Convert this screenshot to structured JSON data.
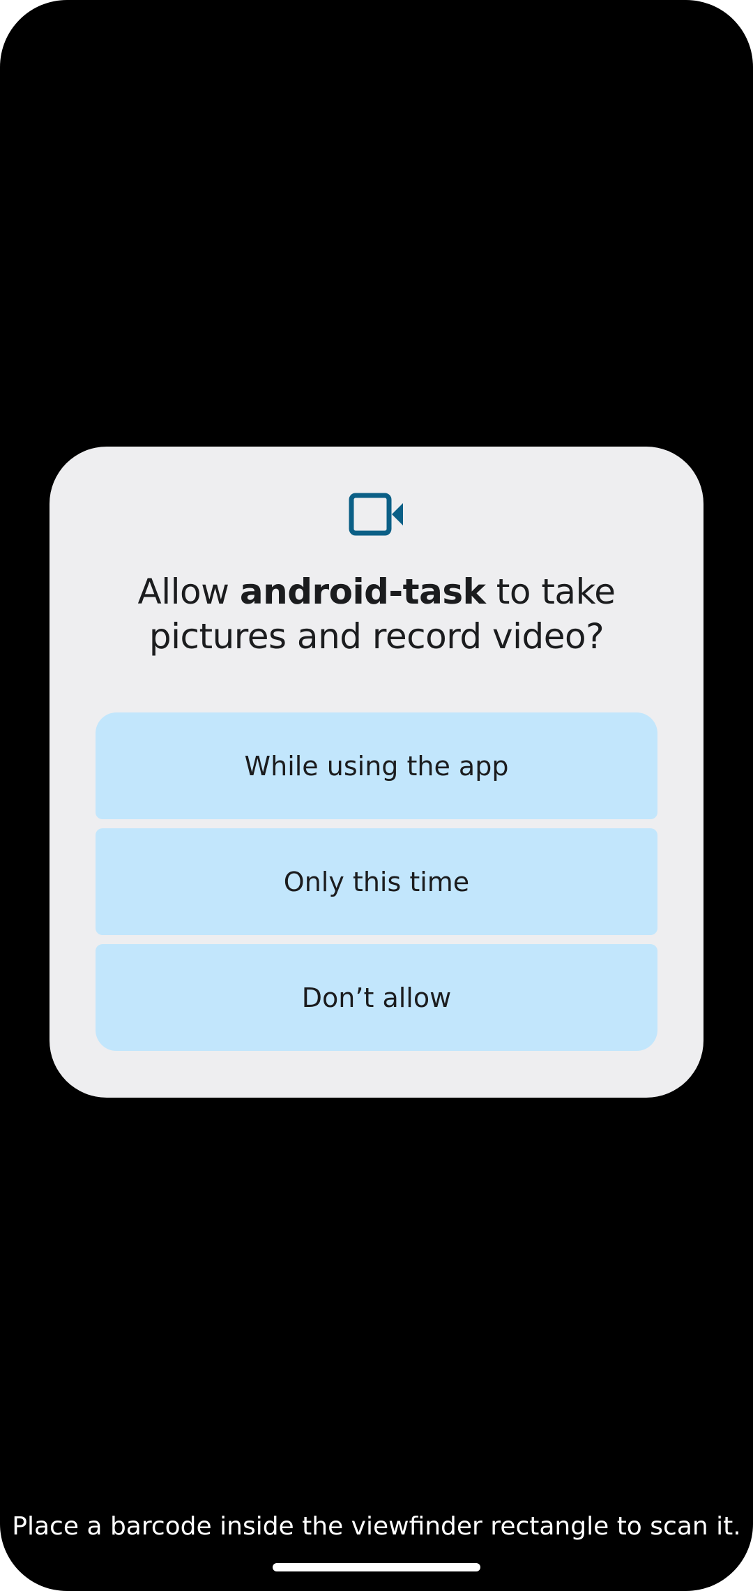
{
  "dialog": {
    "icon": "video-camera-icon",
    "title_prefix": "Allow ",
    "title_app": "android-task",
    "title_suffix": " to take pictures and record video?",
    "buttons": {
      "while_using": "While using the app",
      "only_this_time": "Only this time",
      "dont_allow": "Don’t allow"
    }
  },
  "scanner": {
    "hint": "Place a barcode inside the viewfinder rectangle to scan it."
  },
  "colors": {
    "dialog_background": "#eeeef0",
    "button_background": "#c2e6fc",
    "icon_color": "#0b5f86",
    "screen_background": "#000000"
  }
}
